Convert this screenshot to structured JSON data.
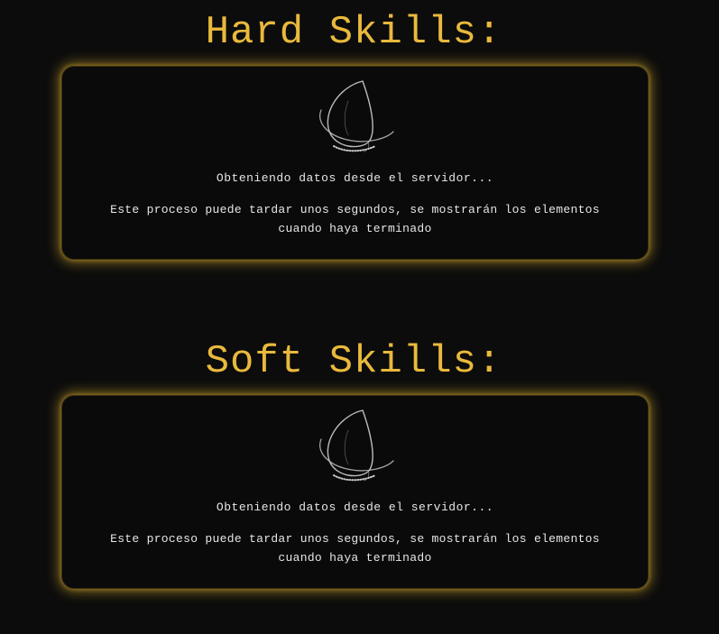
{
  "sections": [
    {
      "title": "Hard Skills:",
      "loading_text": "Obteniendo datos desde el servidor...",
      "info_text": "Este proceso puede tardar unos segundos, se mostrarán los elementos cuando haya terminado",
      "spinner_icon": "loading-spinner-icon"
    },
    {
      "title": "Soft Skills:",
      "loading_text": "Obteniendo datos desde el servidor...",
      "info_text": "Este proceso puede tardar unos segundos, se mostrarán los elementos cuando haya terminado",
      "spinner_icon": "loading-spinner-icon"
    }
  ],
  "colors": {
    "background": "#0c0c0c",
    "accent": "#e9b93c",
    "card_background": "#0a0a0a",
    "text": "#e6e6e6"
  }
}
